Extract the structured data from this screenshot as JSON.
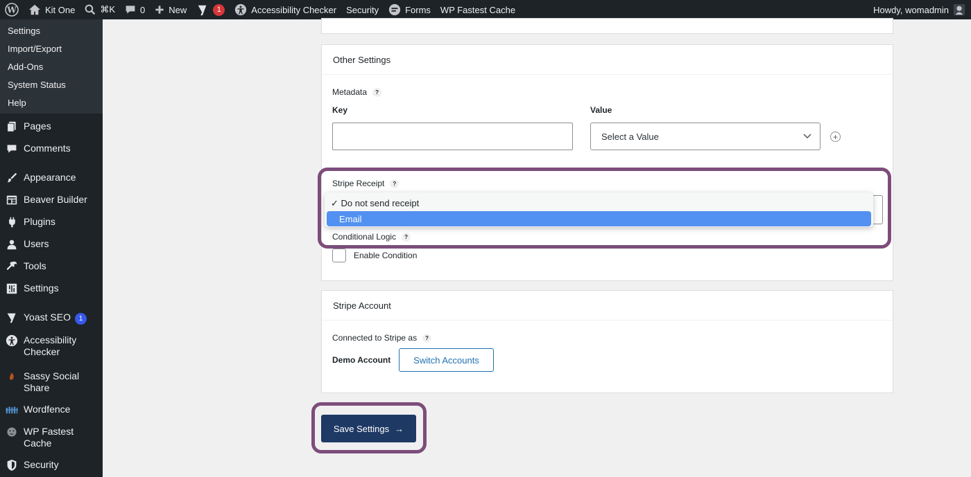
{
  "adminbar": {
    "site_name": "Kit One",
    "search_shortcut": "⌘K",
    "comments_count": "0",
    "new_label": "New",
    "yoast_badge": "1",
    "accessibility_label": "Accessibility Checker",
    "security_label": "Security",
    "forms_label": "Forms",
    "cache_label": "WP Fastest Cache",
    "howdy": "Howdy, womadmin"
  },
  "sidebar": {
    "submenu": [
      "Settings",
      "Import/Export",
      "Add-Ons",
      "System Status",
      "Help"
    ],
    "items": {
      "pages": "Pages",
      "comments": "Comments",
      "appearance": "Appearance",
      "beaver": "Beaver Builder",
      "plugins": "Plugins",
      "users": "Users",
      "tools": "Tools",
      "settings": "Settings",
      "yoast": "Yoast SEO",
      "yoast_count": "1",
      "accessibility": "Accessibility Checker",
      "sassy": "Sassy Social Share",
      "wordfence": "Wordfence",
      "fastest_cache": "WP Fastest Cache",
      "security": "Security"
    }
  },
  "other_settings": {
    "title": "Other Settings",
    "metadata_label": "Metadata",
    "key_label": "Key",
    "value_label": "Value",
    "key_value": "",
    "value_placeholder": "Select a Value",
    "stripe_receipt_label": "Stripe Receipt",
    "receipt_options": [
      "✓ Do not send receipt",
      "Email"
    ],
    "conditional_logic_label": "Conditional Logic",
    "enable_condition_label": "Enable Condition"
  },
  "stripe_account": {
    "title": "Stripe Account",
    "connected_label": "Connected to Stripe as",
    "account_name": "Demo Account",
    "switch_label": "Switch Accounts"
  },
  "save": {
    "label": "Save Settings",
    "arrow": "→"
  },
  "colors": {
    "admin_bar": "#1d2327",
    "highlight_option": "#5291f1",
    "annotation_box": "#7c4d7b",
    "primary_button": "#1e3964",
    "link_blue": "#2271b1"
  }
}
